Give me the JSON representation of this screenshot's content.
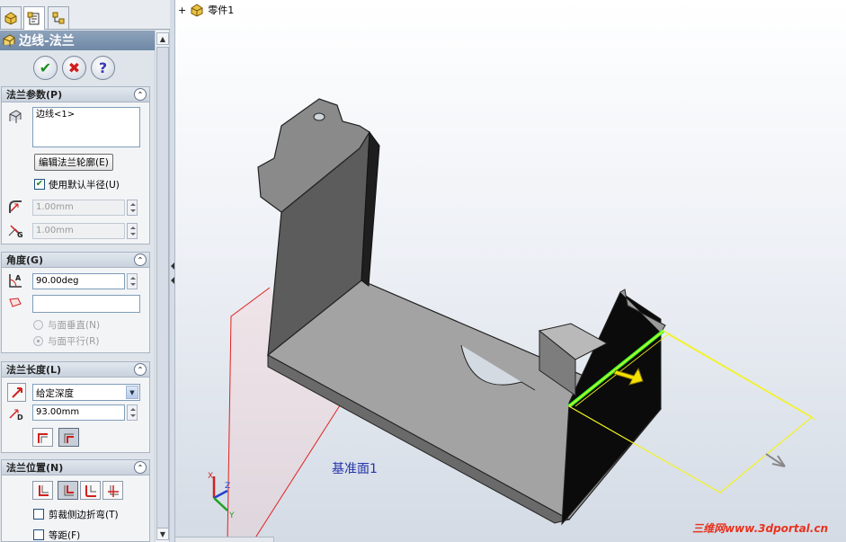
{
  "feature_manager": {
    "title": "边线-法兰",
    "tabs": [
      "feature-manager-tab",
      "property-manager-tab",
      "configuration-manager-tab"
    ]
  },
  "actions": {
    "ok": "✔",
    "cancel": "✖",
    "help": "?"
  },
  "flange_params": {
    "header": "法兰参数(P)",
    "edge_item": "边线<1>",
    "edit_profile_button": "编辑法兰轮廓(E)",
    "use_default_radius_label": "使用默认半径(U)",
    "use_default_radius_checked": true,
    "bend_radius": "1.00mm",
    "gap_distance": "1.00mm"
  },
  "angle": {
    "header": "角度(G)",
    "value": "90.00deg",
    "reference_face": "",
    "option_normal": "与面垂直(N)",
    "option_parallel": "与面平行(R)"
  },
  "flange_length": {
    "header": "法兰长度(L)",
    "end_condition": "给定深度",
    "length": "93.00mm"
  },
  "flange_position": {
    "header": "法兰位置(N)",
    "trim_side_bends": "剪裁侧边折弯(T)",
    "offset": "等距(F)"
  },
  "viewport": {
    "tree_root": "零件1",
    "plane_label": "基准面1",
    "triad": {
      "x": "X",
      "y": "Y",
      "z": "Z"
    },
    "watermark": "三维网www.3dportal.cn"
  },
  "colors": {
    "title_bar": "#7f96b2",
    "plane_outline": "#e02020",
    "preview_outline": "#f3f320",
    "selected_edge": "#33ff33",
    "direction_arrow": "#f5e000"
  }
}
